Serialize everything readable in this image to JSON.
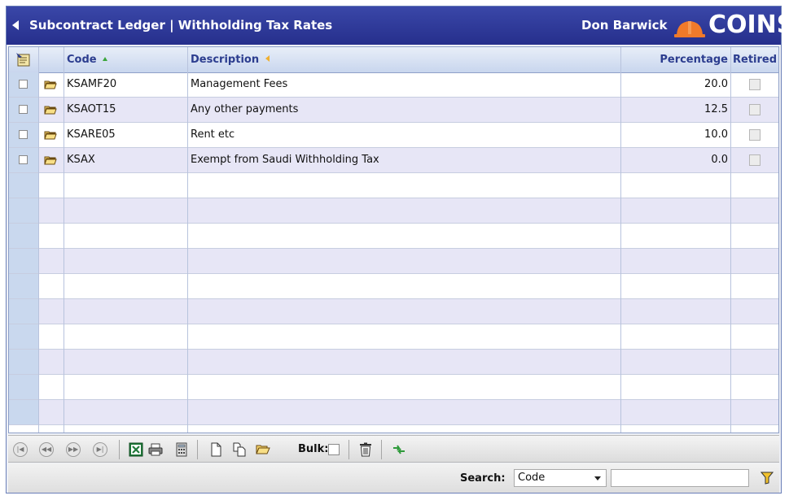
{
  "header": {
    "title": "Subcontract Ledger | Withholding Tax Rates",
    "user": "Don Barwick",
    "logo_text": "COINS",
    "bar_color": "#2b3594",
    "logo_accent": "#f07a2a"
  },
  "grid": {
    "columns": {
      "code": "Code",
      "description": "Description",
      "percentage": "Percentage",
      "retired": "Retired"
    },
    "sort": {
      "code": "ascending",
      "description": "left"
    },
    "rows": [
      {
        "code": "KSAMF20",
        "description": "Management Fees",
        "percentage": "20.0",
        "retired": false
      },
      {
        "code": "KSAOT15",
        "description": "Any other payments",
        "percentage": "12.5",
        "retired": false
      },
      {
        "code": "KSARE05",
        "description": "Rent etc",
        "percentage": "10.0",
        "retired": false
      },
      {
        "code": "KSAX",
        "description": "Exempt from Saudi Withholding Tax",
        "percentage": "0.0",
        "retired": false
      }
    ],
    "row_alt_color": "#e7e6f6",
    "select_column_color": "#c9d8ee"
  },
  "toolbar": {
    "nav_icons": [
      "first-page-icon",
      "previous-page-icon",
      "next-page-icon",
      "last-page-icon"
    ],
    "action_icons": [
      "excel-export-icon",
      "print-icon",
      "calculator-icon",
      "new-document-icon",
      "copy-document-icon",
      "open-folder-icon"
    ],
    "bulk_label": "Bulk:",
    "delete_icon": "trash-icon",
    "refresh_icon": "refresh-icon"
  },
  "search": {
    "label": "Search:",
    "field_selected": "Code",
    "value": "",
    "filter_icon": "filter-icon"
  }
}
